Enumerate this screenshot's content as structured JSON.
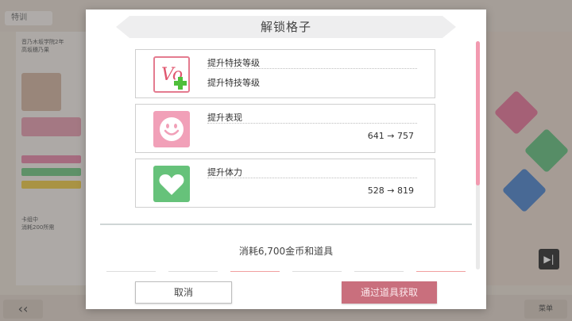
{
  "background": {
    "tab_label": "特训",
    "panel_text": "音乃木坂学院2年\n高坂穗乃果",
    "mini_text": "卡组中\n消耗200所需",
    "right_button_label": "菜单"
  },
  "dialog": {
    "title": "解锁格子",
    "cards": [
      {
        "icon": "vo-skill-up-icon",
        "title": "提升特技等级",
        "subtitle": "提升特技等级",
        "value": ""
      },
      {
        "icon": "smile-icon",
        "title": "提升表现",
        "subtitle": "",
        "value": "641 → 757"
      },
      {
        "icon": "heart-icon",
        "title": "提升体力",
        "subtitle": "",
        "value": "528 → 819"
      }
    ],
    "cost_text": "消耗6,700金币和道具",
    "cancel_label": "取消",
    "obtain_label": "通过道具获取"
  },
  "colors": {
    "smile": "#f1a0b8",
    "heart": "#66c27a",
    "scroll_thumb": "#f29ab0",
    "obtain_button": "#c96f7d"
  }
}
